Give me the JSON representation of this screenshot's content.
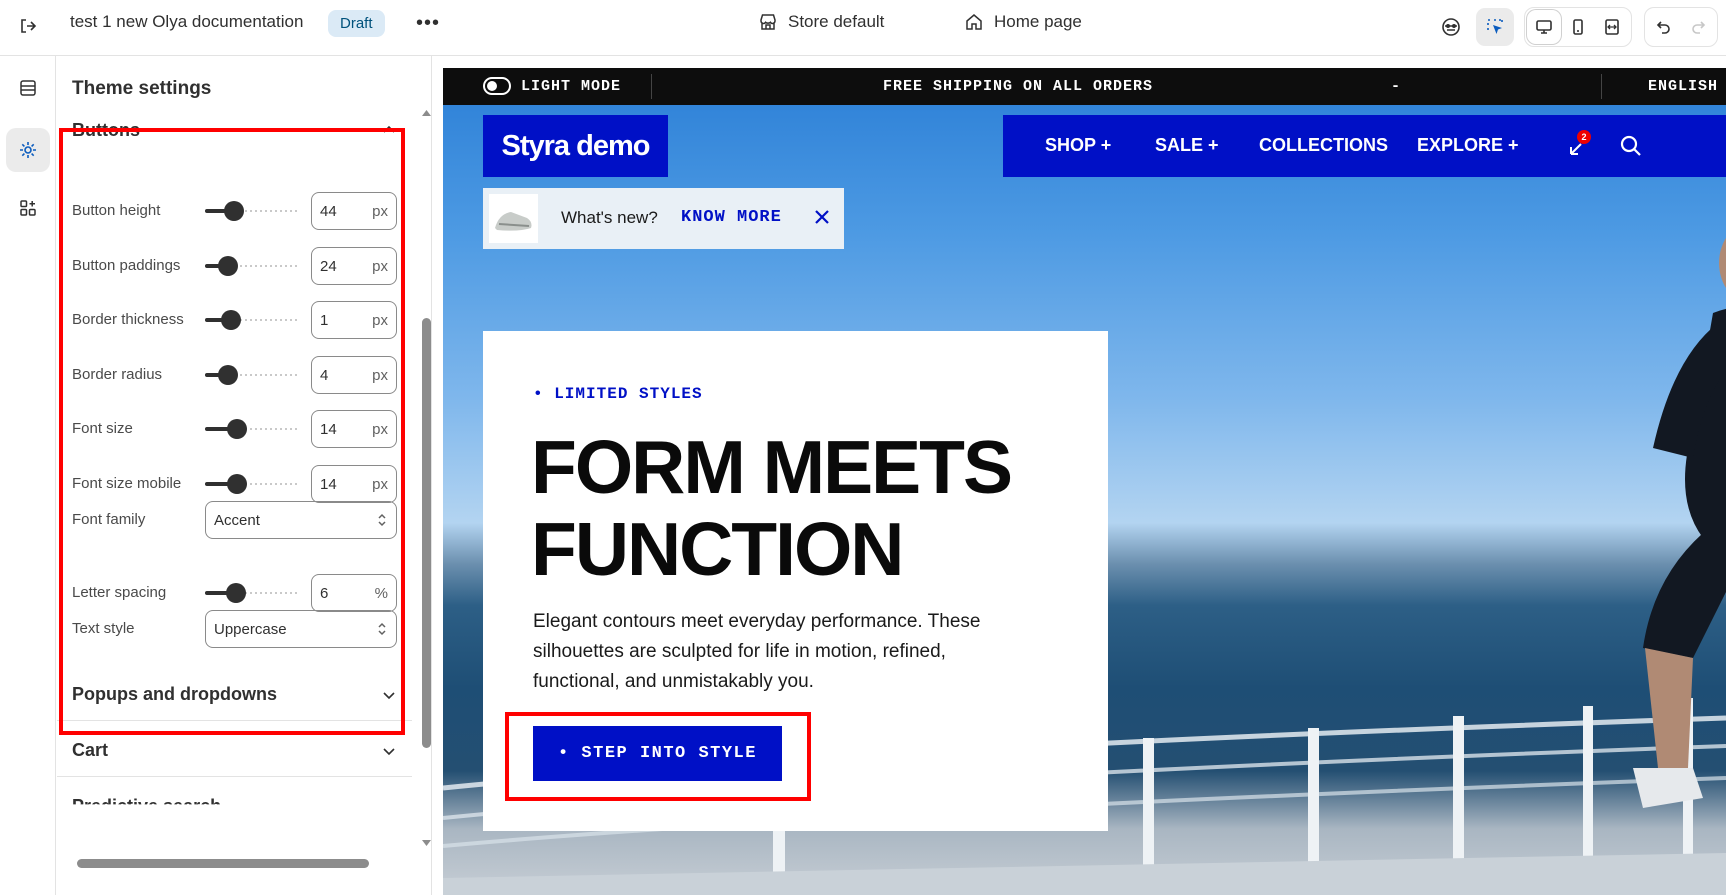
{
  "topbar": {
    "title": "test 1 new Olya documentation",
    "status": "Draft",
    "more": "•••",
    "store": "Store default",
    "page": "Home page"
  },
  "panel": {
    "title": "Theme settings",
    "section_buttons": "Buttons",
    "rows": [
      {
        "label": "Button height",
        "value": "44",
        "unit": "px",
        "level": 0.25
      },
      {
        "label": "Button paddings",
        "value": "24",
        "unit": "px",
        "level": 0.17
      },
      {
        "label": "Border thickness",
        "value": "1",
        "unit": "px",
        "level": 0.22
      },
      {
        "label": "Border radius",
        "value": "4",
        "unit": "px",
        "level": 0.17
      },
      {
        "label": "Font size",
        "value": "14",
        "unit": "px",
        "level": 0.3
      },
      {
        "label": "Font size mobile",
        "value": "14",
        "unit": "px",
        "level": 0.3
      },
      {
        "label": "Letter spacing",
        "value": "6",
        "unit": "%",
        "level": 0.28
      }
    ],
    "font_family": {
      "label": "Font family",
      "value": "Accent"
    },
    "text_style": {
      "label": "Text style",
      "value": "Uppercase"
    },
    "section_popups": "Popups and dropdowns",
    "section_cart": "Cart",
    "section_partial": "Predictive search"
  },
  "preview": {
    "announcement": {
      "mode": "LIGHT MODE",
      "message": "FREE SHIPPING ON ALL ORDERS",
      "dash": "-",
      "language": "ENGLISH"
    },
    "logo": "Styra demo",
    "nav": [
      "SHOP +",
      "SALE +",
      "COLLECTIONS",
      "EXPLORE +"
    ],
    "cart_count": "2",
    "promo": {
      "question": "What's new?",
      "link": "KNOW MORE"
    },
    "hero": {
      "eyebrow": "• LIMITED STYLES",
      "headline": "FORM MEETS FUNCTION",
      "body": "Elegant contours meet everyday performance. These silhouettes are sculpted for life in motion, refined, functional, and unmistakably you.",
      "cta": "• STEP INTO STYLE"
    }
  },
  "colors": {
    "accent": "#0010c6",
    "highlight": "#ff0000",
    "draft_bg": "#dbeaf6"
  }
}
